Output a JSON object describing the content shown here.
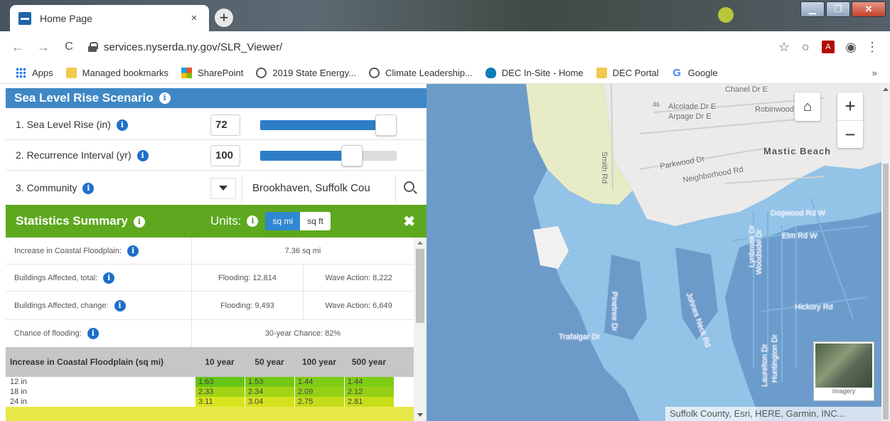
{
  "browser": {
    "tab_title": "Home Page",
    "tab_close": "×",
    "new_tab": "+",
    "url": "services.nyserda.ny.gov/SLR_Viewer/",
    "bookmarks": [
      "Apps",
      "Managed bookmarks",
      "SharePoint",
      "2019 State Energy...",
      "Climate Leadership...",
      "DEC In-Site - Home",
      "DEC Portal",
      "Google"
    ],
    "bookmarks_more": "»"
  },
  "scenario": {
    "title": "Sea Level Rise Scenario",
    "slr_label": "1. Sea Level Rise (in)",
    "slr_value": "72",
    "slr_fraction": 1.0,
    "recurrence_label": "2. Recurrence Interval (yr)",
    "recurrence_value": "100",
    "recurrence_fraction": 0.67,
    "community_label": "3. Community",
    "community_value": "Brookhaven, Suffolk Cou"
  },
  "stats": {
    "title": "Statistics Summary",
    "units_label": "Units:",
    "unit_sqmi": "sq mi",
    "unit_sqft": "sq ft",
    "close": "✖",
    "rows": [
      {
        "label": "Increase in Coastal Floodplain:",
        "value": "7.36 sq mi"
      },
      {
        "label": "Buildings Affected, total:",
        "a": "Flooding: 12,814",
        "b": "Wave Action: 8,222"
      },
      {
        "label": "Buildings Affected, change:",
        "a": "Flooding: 9,493",
        "b": "Wave Action: 6,649"
      },
      {
        "label": "Chance of flooding:",
        "value": "30-year Chance: 82%"
      }
    ]
  },
  "table": {
    "header": "Increase in Coastal Floodplain (sq mi)",
    "columns": [
      "10 year",
      "50 year",
      "100 year",
      "500 year"
    ],
    "rows": [
      {
        "label": "12 in",
        "values": [
          "1.63",
          "1.53",
          "1.44",
          "1.44"
        ],
        "colors": [
          "#66c414",
          "#74c814",
          "#7fcc14",
          "#7fcc14"
        ]
      },
      {
        "label": "18 in",
        "values": [
          "2.33",
          "2.34",
          "2.09",
          "2.12"
        ],
        "colors": [
          "#a2d416",
          "#a2d416",
          "#94d016",
          "#96d016"
        ]
      },
      {
        "label": "24 in",
        "values": [
          "3.11",
          "3.04",
          "2.75",
          "2.81"
        ],
        "colors": [
          "#d9e41e",
          "#d4e21e",
          "#c3dc1a",
          "#c7de1a"
        ]
      }
    ]
  },
  "map": {
    "labels": [
      "Chanel Dr E",
      "Alcolade Dr E",
      "Arpage Dr E",
      "Robinwood D",
      "Mastic Beach",
      "Smith Rd",
      "Parkwood Dr",
      "Neighborhood Rd",
      "Dogwood Rd W",
      "Elm Rd W",
      "Hickory Rd",
      "Trafalgar Dr",
      "Pinetree Dr",
      "Johnes Neck Rd",
      "Lynbrook Dr",
      "Woodside Dr",
      "Laurelton Dr",
      "Huntington Dr",
      "46"
    ],
    "imagery_label": "Imagery",
    "attribution": "Suffolk County, Esri, HERE, Garmin, INC...",
    "zoom_in": "+",
    "zoom_out": "−"
  }
}
